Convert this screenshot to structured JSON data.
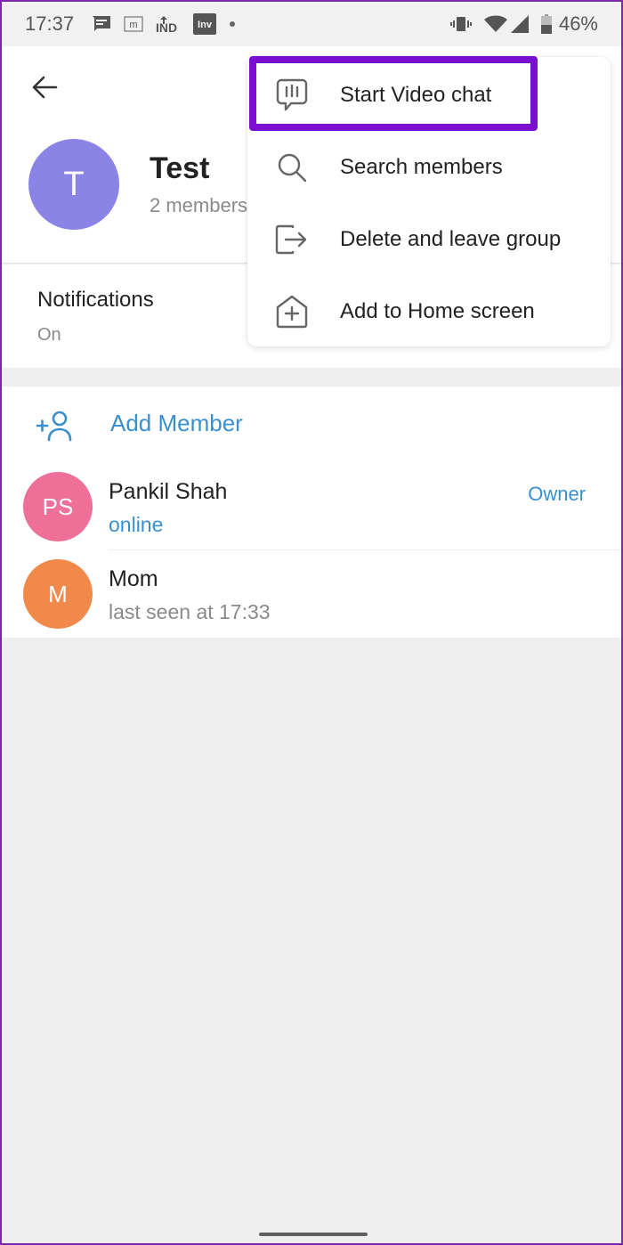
{
  "status_bar": {
    "time": "17:37",
    "notification_icons": [
      "message-icon",
      "m-app-icon",
      "ind-app-icon",
      "inv-app-icon",
      "dot-icon"
    ],
    "inv_label": "Inv",
    "ind_label": "IND",
    "m_label": "m",
    "battery_percent": "46%",
    "right_icons": [
      "vibrate-icon",
      "wifi-icon",
      "signal-icon",
      "battery-icon"
    ]
  },
  "header": {
    "back_icon": "arrow-left-icon",
    "group": {
      "avatar_initial": "T",
      "avatar_color": "#8a84e6",
      "name": "Test",
      "subtitle": "2 members"
    }
  },
  "notifications": {
    "title": "Notifications",
    "value": "On"
  },
  "members": {
    "add_member_label": "Add Member",
    "list": [
      {
        "initials": "PS",
        "name": "Pankil Shah",
        "status": "online",
        "status_color": "#3a8fcc",
        "role": "Owner",
        "avatar_color": "#ee6f97"
      },
      {
        "initials": "M",
        "name": "Mom",
        "status": "last seen at 17:33",
        "status_color": "#8a8a8a",
        "role": "",
        "avatar_color": "#f0894a"
      }
    ]
  },
  "menu": {
    "items": [
      {
        "icon": "video-chat-icon",
        "label": "Start Video chat",
        "highlighted": true
      },
      {
        "icon": "search-icon",
        "label": "Search members"
      },
      {
        "icon": "leave-group-icon",
        "label": "Delete and leave group"
      },
      {
        "icon": "add-home-screen-icon",
        "label": "Add to Home screen"
      }
    ],
    "highlight_color": "#7a0fd0"
  },
  "colors": {
    "accent": "#3a8fcc",
    "background": "#efefef"
  }
}
